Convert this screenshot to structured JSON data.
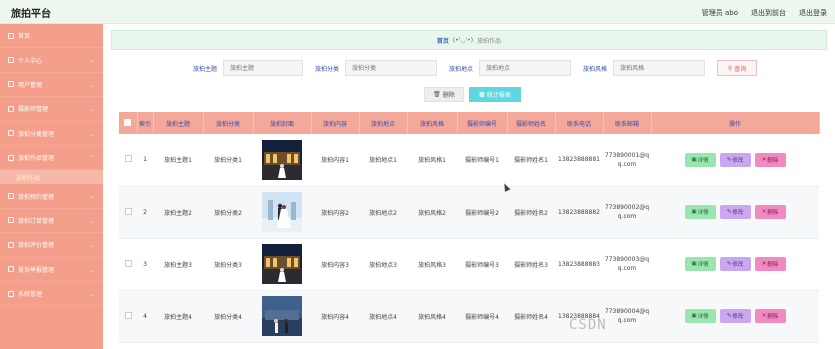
{
  "app": {
    "title": "旅拍平台"
  },
  "header": {
    "links": [
      "管理员 abo",
      "退出到前台",
      "退出登录"
    ]
  },
  "sidebar": {
    "items": [
      {
        "label": "首页",
        "icon": "home-icon",
        "chevron": false
      },
      {
        "label": "个人中心",
        "icon": "user-icon",
        "chevron": true
      },
      {
        "label": "用户管理",
        "icon": "users-icon",
        "chevron": true
      },
      {
        "label": "摄影师管理",
        "icon": "camera-icon",
        "chevron": true
      },
      {
        "label": "旅拍分类管理",
        "icon": "folder-icon",
        "chevron": true
      },
      {
        "label": "旅拍作品管理",
        "icon": "image-icon",
        "chevron": true,
        "expanded": true,
        "sub": [
          "旅拍作品"
        ]
      },
      {
        "label": "旅拍预约管理",
        "icon": "calendar-icon",
        "chevron": true
      },
      {
        "label": "旅拍订单管理",
        "icon": "order-icon",
        "chevron": true
      },
      {
        "label": "旅拍评价管理",
        "icon": "comment-icon",
        "chevron": true
      },
      {
        "label": "投诉举报管理",
        "icon": "report-icon",
        "chevron": true
      },
      {
        "label": "系统管理",
        "icon": "gear-icon",
        "chevron": true
      }
    ]
  },
  "breadcrumb": {
    "home": "首页",
    "face": "(•'◡'•)",
    "current": "旅拍作品"
  },
  "search": {
    "fields": [
      {
        "label": "旅拍主题",
        "placeholder": "旅拍主题"
      },
      {
        "label": "旅拍分类",
        "placeholder": "旅拍分类"
      },
      {
        "label": "旅拍地点",
        "placeholder": "旅拍地点"
      },
      {
        "label": "旅拍风格",
        "placeholder": "旅拍风格"
      }
    ],
    "query_label": "查询"
  },
  "toolbar": {
    "delete_label": "删除",
    "stat_label": "统计报表"
  },
  "table": {
    "headers": [
      "索引",
      "旅拍主题",
      "旅拍分类",
      "旅拍封面",
      "旅拍内容",
      "旅拍地点",
      "旅拍风格",
      "摄影师编号",
      "摄影师姓名",
      "联系电话",
      "联系邮箱",
      "操作"
    ],
    "rows": [
      {
        "index": "1",
        "theme": "旅拍主题1",
        "category": "旅拍分类1",
        "cover": "night",
        "content": "旅拍内容1",
        "place": "旅拍地点1",
        "style": "旅拍风格1",
        "pid": "摄影师编号1",
        "pname": "摄影师姓名1",
        "phone": "13823888881",
        "email1": "773890001@q",
        "email2": "q.com"
      },
      {
        "index": "2",
        "theme": "旅拍主题2",
        "category": "旅拍分类2",
        "cover": "couple",
        "content": "旅拍内容2",
        "place": "旅拍地点2",
        "style": "旅拍风格2",
        "pid": "摄影师编号2",
        "pname": "摄影师姓名2",
        "phone": "13823888882",
        "email1": "773890002@q",
        "email2": "q.com"
      },
      {
        "index": "3",
        "theme": "旅拍主题3",
        "category": "旅拍分类3",
        "cover": "night",
        "content": "旅拍内容3",
        "place": "旅拍地点3",
        "style": "旅拍风格3",
        "pid": "摄影师编号3",
        "pname": "摄影师姓名3",
        "phone": "13823888883",
        "email1": "773890003@q",
        "email2": "q.com"
      },
      {
        "index": "4",
        "theme": "旅拍主题4",
        "category": "旅拍分类4",
        "cover": "dusk",
        "content": "旅拍内容4",
        "place": "旅拍地点4",
        "style": "旅拍风格4",
        "pid": "摄影师编号4",
        "pname": "摄影师姓名4",
        "phone": "13823888884",
        "email1": "773890004@q",
        "email2": "q.com"
      }
    ],
    "ops": {
      "view": "详情",
      "edit": "修改",
      "del": "删除"
    }
  },
  "watermark": "CSDN",
  "colors": {
    "sidebar": "#f39f8b",
    "header_row": "#f3a89a",
    "stat_button": "#5ed7e0",
    "view": "#9ae6b1",
    "edit": "#c9a8f0",
    "delete": "#f08ac1"
  }
}
